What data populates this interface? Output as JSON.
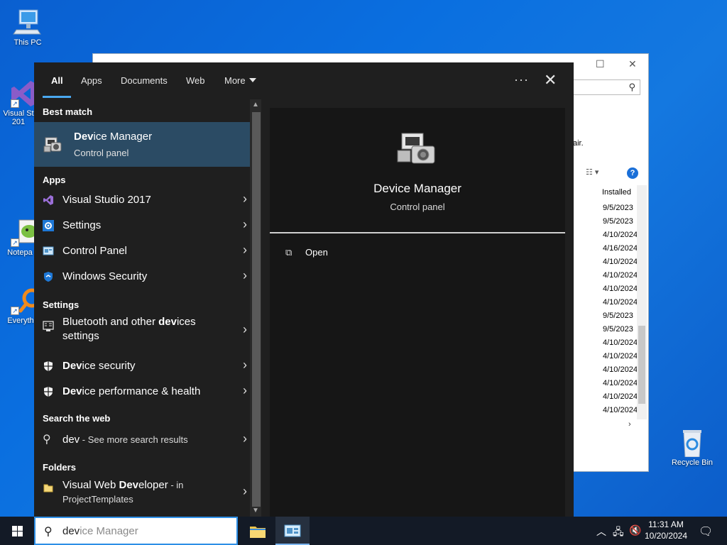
{
  "desktop": {
    "icons": [
      {
        "label": "This PC"
      },
      {
        "label": "Visual St 201"
      },
      {
        "label": "Notepa"
      },
      {
        "label": "Everyth"
      },
      {
        "label": "Recycle Bin"
      }
    ]
  },
  "background_window": {
    "partial_text": "air.",
    "column_header": "Installed",
    "dates": [
      "9/5/2023",
      "9/5/2023",
      "4/10/2024",
      "4/16/2024",
      "4/10/2024",
      "4/10/2024",
      "4/10/2024",
      "4/10/2024",
      "9/5/2023",
      "9/5/2023",
      "4/10/2024",
      "4/10/2024",
      "4/10/2024",
      "4/10/2024",
      "4/10/2024",
      "4/10/2024"
    ],
    "help_label": "?"
  },
  "search_panel": {
    "tabs": [
      {
        "label": "All",
        "active": true
      },
      {
        "label": "Apps"
      },
      {
        "label": "Documents"
      },
      {
        "label": "Web"
      },
      {
        "label": "More"
      }
    ],
    "more_options_label": "···",
    "close_label": "✕",
    "sections": {
      "best_match": "Best match",
      "apps": "Apps",
      "settings": "Settings",
      "search_web": "Search the web",
      "folders": "Folders"
    },
    "best_match": {
      "title_bold": "Dev",
      "title_rest": "ice Manager",
      "subtitle": "Control panel"
    },
    "apps": [
      {
        "label": "Visual Studio 2017",
        "icon": "visual-studio-icon"
      },
      {
        "label": "Settings",
        "icon": "settings-gear-icon"
      },
      {
        "label": "Control Panel",
        "icon": "control-panel-icon"
      },
      {
        "label": "Windows Security",
        "icon": "windows-security-shield-icon"
      }
    ],
    "settings": [
      {
        "pre": "Bluetooth and other ",
        "bold": "dev",
        "post": "ices",
        "line2": "settings",
        "icon": "bluetooth-devices-icon"
      },
      {
        "pre": "",
        "bold": "Dev",
        "post": "ice security",
        "icon": "shield-icon"
      },
      {
        "pre": "",
        "bold": "Dev",
        "post": "ice performance & health",
        "icon": "shield-icon"
      }
    ],
    "web": {
      "query": "dev",
      "suffix": " - See more search results"
    },
    "folders": [
      {
        "pre": "Visual Web ",
        "bold": "Dev",
        "post": "eloper",
        "suffix": " - in",
        "line2": "ProjectTemplates"
      }
    ],
    "preview": {
      "title": "Device Manager",
      "subtitle": "Control panel",
      "open_label": "Open"
    }
  },
  "taskbar": {
    "search": {
      "typed": "dev",
      "suggestion_rest": "ice Manager"
    },
    "clock": {
      "time": "11:31 AM",
      "date": "10/20/2024"
    }
  }
}
